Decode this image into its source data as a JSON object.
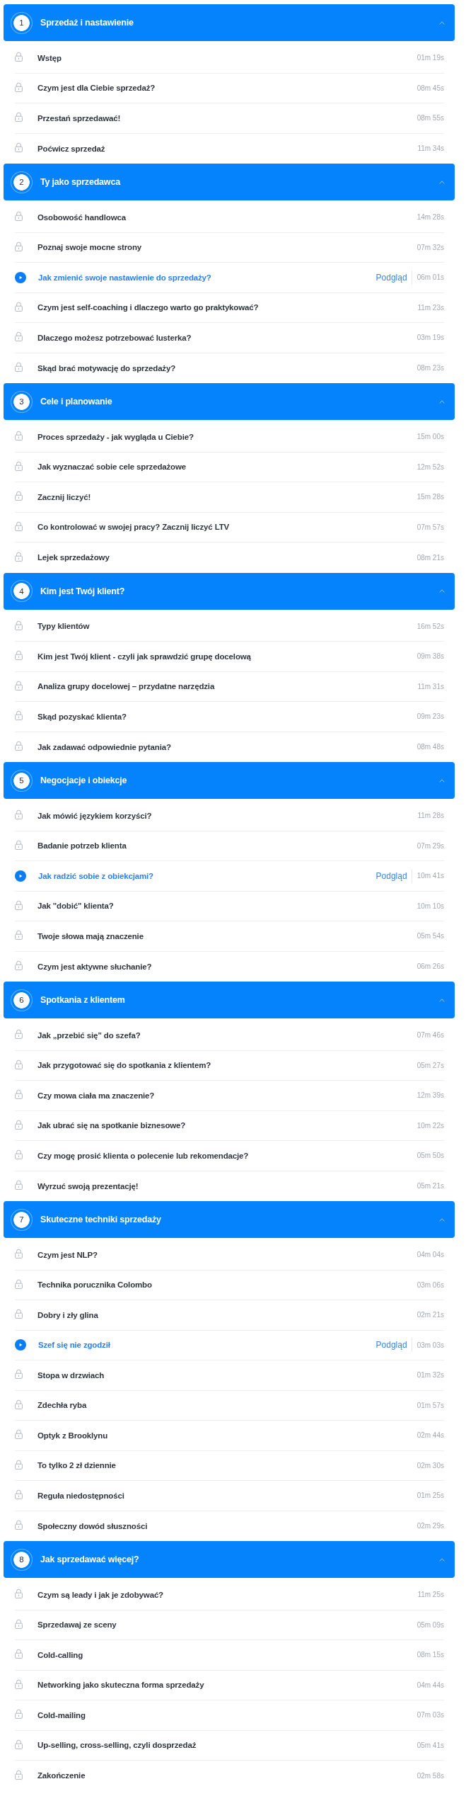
{
  "sections": [
    {
      "number": "1",
      "title": "Sprzedaż i nastawienie",
      "expanded": true,
      "lessons": [
        {
          "kind": "locked",
          "title": "Wstęp",
          "duration": "01m 19s"
        },
        {
          "kind": "locked",
          "title": "Czym jest dla Ciebie sprzedaż?",
          "duration": "08m 45s"
        },
        {
          "kind": "locked",
          "title": "Przestań sprzedawać!",
          "duration": "08m 55s"
        },
        {
          "kind": "locked",
          "title": "Poćwicz sprzedaż",
          "duration": "11m 34s"
        }
      ]
    },
    {
      "number": "2",
      "title": "Ty jako sprzedawca",
      "expanded": true,
      "lessons": [
        {
          "kind": "locked",
          "title": "Osobowość handlowca",
          "duration": "14m 28s"
        },
        {
          "kind": "locked",
          "title": "Poznaj swoje mocne strony",
          "duration": "07m 32s"
        },
        {
          "kind": "preview",
          "title": "Jak zmienić swoje nastawienie do sprzedaży?",
          "preview_label": "Podgląd",
          "duration": "06m 01s"
        },
        {
          "kind": "locked",
          "title": "Czym jest self-coaching i dlaczego warto go praktykować?",
          "duration": "11m 23s"
        },
        {
          "kind": "locked",
          "title": "Dlaczego możesz potrzebować lusterka?",
          "duration": "03m 19s"
        },
        {
          "kind": "locked",
          "title": "Skąd brać motywację do sprzedaży?",
          "duration": "08m 23s"
        }
      ]
    },
    {
      "number": "3",
      "title": "Cele i planowanie",
      "expanded": true,
      "lessons": [
        {
          "kind": "locked",
          "title": "Proces sprzedaży - jak wygląda u Ciebie?",
          "duration": "15m 00s"
        },
        {
          "kind": "locked",
          "title": "Jak wyznaczać sobie cele sprzedażowe",
          "duration": "12m 52s"
        },
        {
          "kind": "locked",
          "title": "Zacznij liczyć!",
          "duration": "15m 28s"
        },
        {
          "kind": "locked",
          "title": "Co kontrolować w swojej pracy? Zacznij liczyć LTV",
          "duration": "07m 57s"
        },
        {
          "kind": "locked",
          "title": "Lejek sprzedażowy",
          "duration": "08m 21s"
        }
      ]
    },
    {
      "number": "4",
      "title": "Kim jest Twój klient?",
      "expanded": true,
      "lessons": [
        {
          "kind": "locked",
          "title": "Typy klientów",
          "duration": "16m 52s"
        },
        {
          "kind": "locked",
          "title": "Kim jest Twój klient - czyli jak sprawdzić grupę docelową",
          "duration": "09m 38s"
        },
        {
          "kind": "locked",
          "title": "Analiza grupy docelowej – przydatne narzędzia",
          "duration": "11m 31s"
        },
        {
          "kind": "locked",
          "title": "Skąd pozyskać klienta?",
          "duration": "09m 23s"
        },
        {
          "kind": "locked",
          "title": "Jak zadawać odpowiednie pytania?",
          "duration": "08m 48s"
        }
      ]
    },
    {
      "number": "5",
      "title": "Negocjacje i obiekcje",
      "expanded": true,
      "lessons": [
        {
          "kind": "locked",
          "title": "Jak mówić językiem korzyści?",
          "duration": "11m 28s"
        },
        {
          "kind": "locked",
          "title": "Badanie potrzeb klienta",
          "duration": "07m 29s"
        },
        {
          "kind": "preview",
          "title": "Jak radzić sobie z obiekcjami?",
          "preview_label": "Podgląd",
          "duration": "10m 41s"
        },
        {
          "kind": "locked",
          "title": "Jak \"dobić\" klienta?",
          "duration": "10m 10s"
        },
        {
          "kind": "locked",
          "title": "Twoje słowa mają znaczenie",
          "duration": "05m 54s"
        },
        {
          "kind": "locked",
          "title": "Czym jest aktywne słuchanie?",
          "duration": "06m 26s"
        }
      ]
    },
    {
      "number": "6",
      "title": "Spotkania z klientem",
      "expanded": true,
      "lessons": [
        {
          "kind": "locked",
          "title": "Jak „przebić się” do szefa?",
          "duration": "07m 46s"
        },
        {
          "kind": "locked",
          "title": "Jak przygotować się do spotkania z klientem?",
          "duration": "05m 27s"
        },
        {
          "kind": "locked",
          "title": "Czy mowa ciała ma znaczenie?",
          "duration": "12m 39s"
        },
        {
          "kind": "locked",
          "title": "Jak ubrać się na spotkanie biznesowe?",
          "duration": "10m 22s"
        },
        {
          "kind": "locked",
          "title": "Czy mogę prosić klienta o polecenie lub rekomendacje?",
          "duration": "05m 50s"
        },
        {
          "kind": "locked",
          "title": "Wyrzuć swoją prezentację!",
          "duration": "05m 21s"
        }
      ]
    },
    {
      "number": "7",
      "title": "Skuteczne techniki sprzedaży",
      "expanded": true,
      "lessons": [
        {
          "kind": "locked",
          "title": "Czym jest NLP?",
          "duration": "04m 04s"
        },
        {
          "kind": "locked",
          "title": "Technika porucznika Colombo",
          "duration": "03m 06s"
        },
        {
          "kind": "locked",
          "title": "Dobry i zły glina",
          "duration": "02m 21s"
        },
        {
          "kind": "preview",
          "title": "Szef się nie zgodził",
          "preview_label": "Podgląd",
          "duration": "03m 03s"
        },
        {
          "kind": "locked",
          "title": "Stopa w drzwiach",
          "duration": "01m 32s"
        },
        {
          "kind": "locked",
          "title": "Zdechła ryba",
          "duration": "01m 57s"
        },
        {
          "kind": "locked",
          "title": "Optyk z Brooklynu",
          "duration": "02m 44s"
        },
        {
          "kind": "locked",
          "title": "To tylko 2 zł dziennie",
          "duration": "02m 30s"
        },
        {
          "kind": "locked",
          "title": "Reguła niedostępności",
          "duration": "01m 25s"
        },
        {
          "kind": "locked",
          "title": "Społeczny dowód słuszności",
          "duration": "02m 29s"
        }
      ]
    },
    {
      "number": "8",
      "title": "Jak sprzedawać więcej?",
      "expanded": true,
      "lessons": [
        {
          "kind": "locked",
          "title": "Czym są leady i jak je zdobywać?",
          "duration": "11m 25s"
        },
        {
          "kind": "locked",
          "title": "Sprzedawaj ze sceny",
          "duration": "05m 09s"
        },
        {
          "kind": "locked",
          "title": "Cold-calling",
          "duration": "08m 15s"
        },
        {
          "kind": "locked",
          "title": "Networking jako skuteczna forma sprzedaży",
          "duration": "04m 44s"
        },
        {
          "kind": "locked",
          "title": "Cold-mailing",
          "duration": "07m 03s"
        },
        {
          "kind": "locked",
          "title": "Up-selling, cross-selling, czyli dosprzedaż",
          "duration": "05m 41s"
        },
        {
          "kind": "locked",
          "title": "Zakończenie",
          "duration": "02m 58s"
        }
      ]
    }
  ]
}
